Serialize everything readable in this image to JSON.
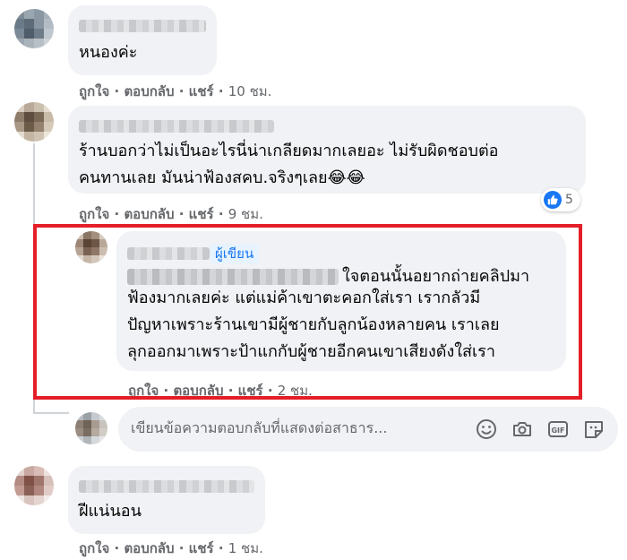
{
  "comments": [
    {
      "text": "หนองค่ะ",
      "actions": {
        "like": "ถูกใจ",
        "reply": "ตอบกลับ",
        "share": "แชร์",
        "time": "10 ชม."
      }
    },
    {
      "text": "ร้านบอกว่าไม่เป็นอะไรนี่น่าเกลียดมากเลยอะ ไม่รับผิดชอบต่อ\nคนทานเลย มันน่าฟ้องสคบ.จริงๆเลย😂😂",
      "reaction": {
        "icon": "like-icon",
        "count": "5"
      },
      "actions": {
        "like": "ถูกใจ",
        "reply": "ตอบกลับ",
        "share": "แชร์",
        "time": "9 ชม."
      }
    },
    {
      "badge": "ผู้เขียน",
      "text_line1": "ใจตอนนั้นอยากถ่ายคลิปมา",
      "text_rest": "ฟ้องมากเลยค่ะ แต่แม่ค้าเขาตะคอกใส่เรา เรากลัวมี\nปัญหาเพราะร้านเขามีผู้ชายกับลูกน้องหลายคน เราเลย\nลุกออกมาเพราะป้าแกกับผู้ชายอีกคนเขาเสียงดังใส่เรา",
      "actions": {
        "like": "ถูกใจ",
        "reply": "ตอบกลับ",
        "share": "แชร์",
        "time": "2 ชม."
      }
    },
    {
      "text": "ฝีแน่นอน",
      "actions": {
        "like": "ถูกใจ",
        "reply": "ตอบกลับ",
        "share": "แชร์",
        "time": "1 ชม."
      }
    }
  ],
  "reply_box": {
    "placeholder": "เขียนข้อความตอบกลับที่แสดงต่อสาธาร...",
    "icons": [
      "emoji-icon",
      "camera-icon",
      "gif-icon",
      "sticker-icon"
    ]
  },
  "colors": {
    "highlight": "#e41e26",
    "bubble": "#f0f2f5",
    "accent": "#1877f2",
    "meta": "#65676b"
  }
}
